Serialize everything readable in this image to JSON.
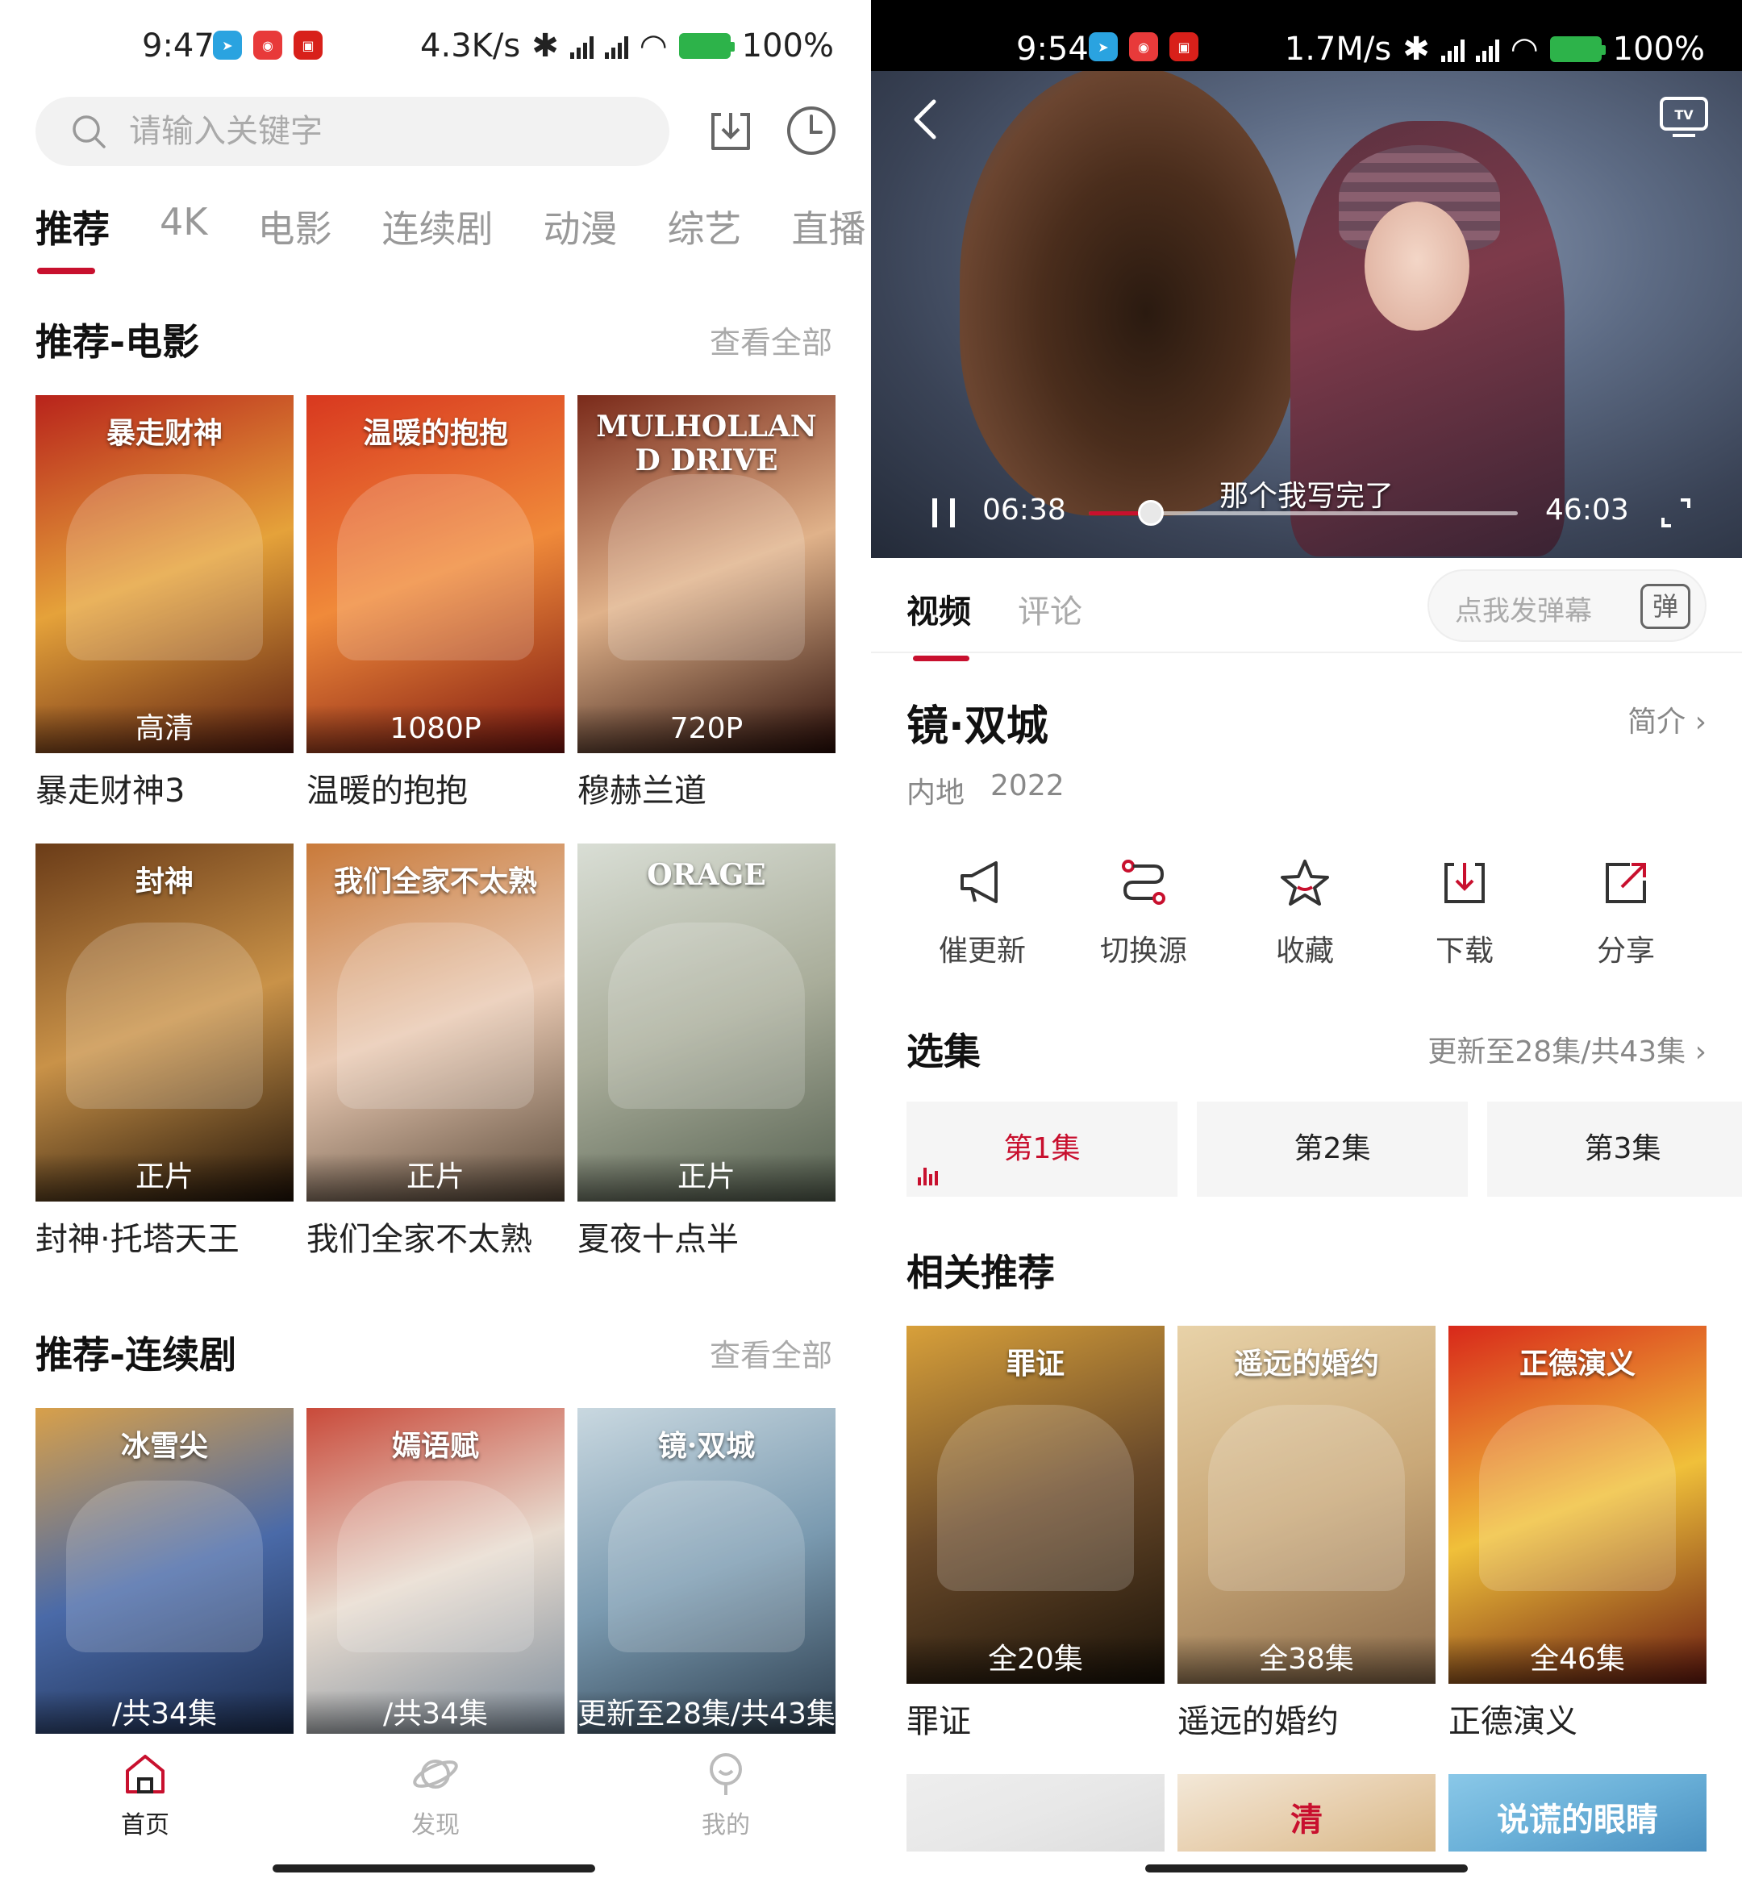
{
  "left": {
    "status": {
      "time": "9:47",
      "net_speed": "4.3K/s",
      "battery": "100%"
    },
    "search": {
      "placeholder": "请输入关键字"
    },
    "tabs": [
      "推荐",
      "4K",
      "电影",
      "连续剧",
      "动漫",
      "综艺",
      "直播"
    ],
    "sections": [
      {
        "title": "推荐-电影",
        "more": "查看全部",
        "items": [
          {
            "title": "暴走财神3",
            "badge": "高清",
            "poster_text": "暴走财神",
            "colors": [
              "#b8231b",
              "#e5a23a",
              "#5a1c10"
            ]
          },
          {
            "title": "温暖的抱抱",
            "badge": "1080P",
            "poster_text": "温暖的抱抱",
            "colors": [
              "#d8381f",
              "#f08a3a",
              "#7a1510"
            ]
          },
          {
            "title": "穆赫兰道",
            "badge": "720P",
            "poster_text": "MULHOLLAND DRIVE",
            "colors": [
              "#7a2a1a",
              "#e0b28a",
              "#2a0d08"
            ]
          },
          {
            "title": "封神·托塔天王",
            "badge": "正片",
            "poster_text": "封神",
            "colors": [
              "#6b3c18",
              "#c99248",
              "#1f1208"
            ]
          },
          {
            "title": "我们全家不太熟",
            "badge": "正片",
            "poster_text": "我们全家不太熟",
            "colors": [
              "#c97a3a",
              "#e9c9b2",
              "#5a4a3a"
            ]
          },
          {
            "title": "夏夜十点半",
            "badge": "正片",
            "poster_text": "ORAGE",
            "colors": [
              "#d9ded5",
              "#a9ad9a",
              "#556050"
            ]
          }
        ]
      },
      {
        "title": "推荐-连续剧",
        "more": "查看全部",
        "items": [
          {
            "title": "",
            "badge": "/共34集",
            "poster_text": "冰雪尖",
            "colors": [
              "#d8a04a",
              "#4a6aa8",
              "#1a2a4a"
            ]
          },
          {
            "title": "",
            "badge": "/共34集",
            "poster_text": "嫣语赋",
            "colors": [
              "#c94a3a",
              "#e8dcd0",
              "#7a8a9a"
            ]
          },
          {
            "title": "",
            "badge": "更新至28集/共43集",
            "poster_text": "镜·双城",
            "colors": [
              "#c9d8e0",
              "#7a9ab0",
              "#2a3a4a"
            ]
          }
        ]
      }
    ],
    "nav": [
      {
        "label": "首页",
        "icon": "home-icon",
        "active": true
      },
      {
        "label": "发现",
        "icon": "planet-icon",
        "active": false
      },
      {
        "label": "我的",
        "icon": "user-icon",
        "active": false
      }
    ]
  },
  "right": {
    "status": {
      "time": "9:54",
      "net_speed": "1.7M/s",
      "battery": "100%"
    },
    "player": {
      "subtitle": "那个我写完了",
      "current_time": "06:38",
      "total_time": "46:03",
      "progress": 0.144
    },
    "tabs": [
      "视频",
      "评论"
    ],
    "danmu_placeholder": "点我发弹幕",
    "danmu_button": "弹",
    "show": {
      "title": "镜·双城",
      "intro": "简介",
      "region": "内地",
      "year": "2022"
    },
    "actions": [
      {
        "label": "催更新",
        "icon": "megaphone-icon"
      },
      {
        "label": "切换源",
        "icon": "switch-source-icon"
      },
      {
        "label": "收藏",
        "icon": "star-icon"
      },
      {
        "label": "下载",
        "icon": "download-icon"
      },
      {
        "label": "分享",
        "icon": "share-icon"
      }
    ],
    "episodes": {
      "title": "选集",
      "status": "更新至28集/共43集",
      "items": [
        "第1集",
        "第2集",
        "第3集"
      ]
    },
    "related": {
      "title": "相关推荐",
      "items": [
        {
          "title": "罪证",
          "badge": "全20集",
          "poster_text": "罪证",
          "colors": [
            "#d8a03a",
            "#6a4a2a",
            "#1a1208"
          ]
        },
        {
          "title": "遥远的婚约",
          "badge": "全38集",
          "poster_text": "遥远的婚约",
          "colors": [
            "#e8d2a8",
            "#c9a878",
            "#8a6a4a"
          ]
        },
        {
          "title": "正德演义",
          "badge": "全46集",
          "poster_text": "正德演义",
          "colors": [
            "#d8281a",
            "#f0c03a",
            "#6a1a10"
          ]
        }
      ],
      "partial": [
        "",
        "清",
        "说谎的眼睛"
      ]
    }
  }
}
